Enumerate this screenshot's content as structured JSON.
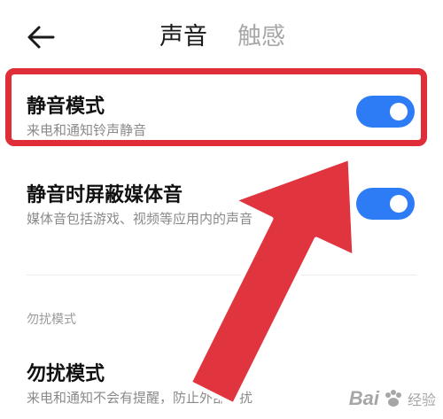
{
  "header": {
    "back_icon": "arrow-left-icon",
    "tabs": [
      {
        "label": "声音",
        "active": true
      },
      {
        "label": "触感",
        "active": false
      }
    ]
  },
  "settings": {
    "mute_mode": {
      "title": "静音模式",
      "subtitle": "来电和通知铃声静音",
      "enabled": true
    },
    "mute_media": {
      "title": "静音时屏蔽媒体音",
      "subtitle": "媒体音包括游戏、视频等应用内的声音",
      "enabled": true
    },
    "dnd_section_label": "勿扰模式",
    "dnd": {
      "title": "勿扰模式",
      "subtitle": "来电和通知不会有提醒，防止外部打扰"
    }
  },
  "colors": {
    "toggle_on": "#2d7cf6",
    "highlight": "#e02e38",
    "arrow": "#e0353f"
  },
  "watermark": {
    "brand": "Bai",
    "brand_icon": "paw-icon",
    "brand_tail": "经验"
  }
}
